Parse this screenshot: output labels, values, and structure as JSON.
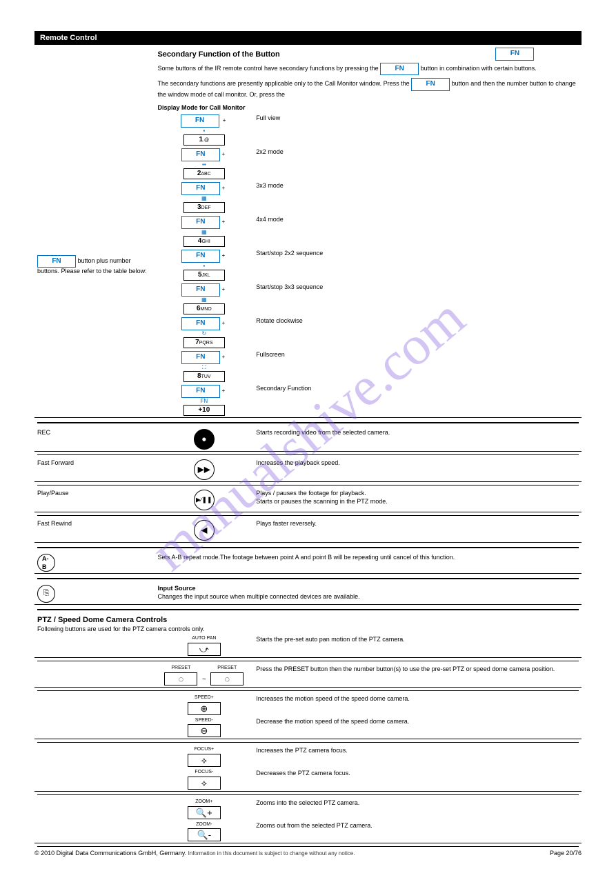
{
  "header": "Remote Control",
  "watermark": "manualshive.com",
  "fn_label": "FN",
  "intro": {
    "sec_prefix": "Secondary Function of the ",
    "sec_suffix": " Button",
    "p1a": "Some buttons of the IR remote control have secondary functions by pressing the ",
    "p1b": " button in combination with certain buttons.",
    "p2a": "The secondary functions are presently applicable only to the Call Monitor window. Press the ",
    "p2b": " button and then the number button to change the window mode of call monitor. Or, press the "
  },
  "mode_title": "Display Mode for Call Monitor",
  "num_intro": " button plus number buttons. Please refer to the table below:",
  "num_rows": [
    {
      "top": "icon-1x1",
      "num": "1",
      "sub": ".@",
      "desc": "Full view"
    },
    {
      "top": "icon-2x2",
      "num": "2",
      "sub": "ABC",
      "desc": "2x2 mode"
    },
    {
      "top": "icon-3x3",
      "num": "3",
      "sub": "DEF",
      "desc": "3x3 mode"
    },
    {
      "top": "icon-4x4",
      "num": "4",
      "sub": "GHI",
      "desc": "4x4 mode"
    },
    {
      "top": "icon-seq-sm",
      "num": "5",
      "sub": "JKL",
      "desc": "Start/stop 2x2 sequence"
    },
    {
      "top": "icon-seq-md",
      "num": "6",
      "sub": "MNO",
      "desc": "Start/stop 3x3 sequence"
    },
    {
      "top": "icon-rotate",
      "num": "7",
      "sub": "PQRS",
      "desc": "Rotate clockwise"
    },
    {
      "top": "icon-full",
      "num": "8",
      "sub": "TUV",
      "desc": "Fullscreen"
    },
    {
      "top": "icon-fn",
      "num": "+10",
      "sub": "",
      "desc": "Secondary Function"
    }
  ],
  "rec_row": {
    "name": "REC",
    "desc": "Starts recording video from the selected camera."
  },
  "other_rows": [
    {
      "name": "Fast Forward",
      "icon": "▶▶",
      "desc": "Increases the playback speed."
    },
    {
      "name": "Play/Pause",
      "icon": "▶∕❚❚",
      "desc_a": "Plays / pauses the footage for playback.",
      "desc_b": "Starts or pauses the scanning in the PTZ mode."
    },
    {
      "name": "Fast Rewind",
      "icon": "◀",
      "desc": "Plays faster reversely."
    }
  ],
  "ab_row": {
    "name": "A-B",
    "desc": "Sets A-B repeat mode.The footage between point A and point B will be repeating until cancel of this function."
  },
  "src_row": {
    "name": "Input Source",
    "desc": "Changes the input source when multiple connected devices are available."
  },
  "ptz_head": "PTZ / Speed Dome Camera Controls",
  "ptz_intro": "Following buttons are used for the PTZ camera controls only.",
  "autopan": {
    "label": "AUTO PAN",
    "desc": "Starts the pre-set auto pan motion of the PTZ camera."
  },
  "preset": {
    "label": "PRESET",
    "joiner": "~",
    "desc": "Press the PRESET button then the number button(s) to use the pre-set PTZ or speed dome camera position."
  },
  "speed_plus": {
    "label": "SPEED+",
    "desc": "Increases the motion speed of the speed dome camera."
  },
  "speed_minus": {
    "label": "SPEED-",
    "desc": "Decrease the motion speed of the speed dome camera."
  },
  "focus_plus": {
    "label": "FOCUS+",
    "desc": "Increases the PTZ camera focus."
  },
  "focus_minus": {
    "label": "FOCUS-",
    "desc": "Decreases the PTZ camera focus."
  },
  "zoom_plus": {
    "label": "ZOOM+",
    "desc": "Zooms into the selected PTZ camera."
  },
  "zoom_minus": {
    "label": "ZOOM-",
    "desc": "Zooms out from the selected PTZ camera."
  },
  "footer": {
    "left": "© 2010 Digital Data Communications GmbH, Germany. ",
    "right": "Page 20/76",
    "small": "Information in this document is subject to change without any notice."
  }
}
